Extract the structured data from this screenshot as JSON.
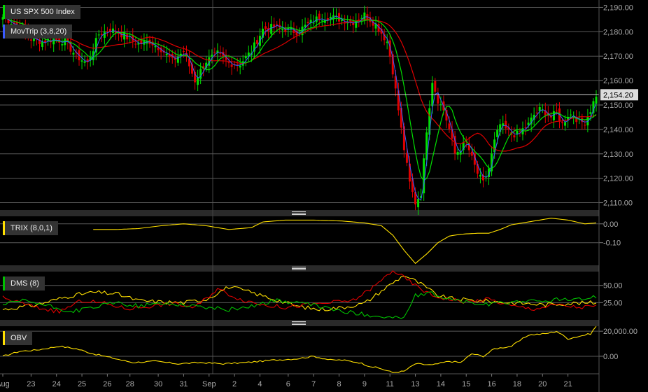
{
  "chart_data": [
    {
      "type": "candlestick",
      "title": "US SPX 500 Index",
      "ylim": [
        2107,
        2193
      ],
      "y_ticks": [
        2110,
        2120,
        2130,
        2140,
        2150,
        2160,
        2170,
        2180,
        2190
      ],
      "y_tick_labels": [
        "2,110.00",
        "2,120.00",
        "2,130.00",
        "2,140.00",
        "2,150.00",
        "2,160.00",
        "2,170.00",
        "2,180.00",
        "2,190.00"
      ],
      "last_price_label": "2,154.20",
      "last_price": 2154.2,
      "series": [
        {
          "name": "US SPX 500 Index",
          "close_anchors": [
            [
              0,
              2186
            ],
            [
              6,
              2182
            ],
            [
              10,
              2177
            ],
            [
              14,
              2176
            ],
            [
              18,
              2177
            ],
            [
              22,
              2176
            ],
            [
              26,
              2170
            ],
            [
              30,
              2167
            ],
            [
              34,
              2179
            ],
            [
              38,
              2181
            ],
            [
              42,
              2179
            ],
            [
              48,
              2175
            ],
            [
              52,
              2176
            ],
            [
              56,
              2173
            ],
            [
              60,
              2168
            ],
            [
              64,
              2172
            ],
            [
              68,
              2160
            ],
            [
              72,
              2168
            ],
            [
              76,
              2171
            ],
            [
              80,
              2167
            ],
            [
              84,
              2167
            ],
            [
              88,
              2172
            ],
            [
              92,
              2181
            ],
            [
              96,
              2182
            ],
            [
              100,
              2181
            ],
            [
              104,
              2180
            ],
            [
              108,
              2183
            ],
            [
              112,
              2186
            ],
            [
              116,
              2186
            ],
            [
              120,
              2185
            ],
            [
              124,
              2184
            ],
            [
              128,
              2187
            ],
            [
              132,
              2183
            ],
            [
              136,
              2176
            ],
            [
              138,
              2164
            ],
            [
              140,
              2148
            ],
            [
              142,
              2132
            ],
            [
              144,
              2118
            ],
            [
              146,
              2110
            ],
            [
              148,
              2114
            ],
            [
              150,
              2140
            ],
            [
              152,
              2160
            ],
            [
              154,
              2152
            ],
            [
              156,
              2148
            ],
            [
              158,
              2140
            ],
            [
              160,
              2130
            ],
            [
              162,
              2132
            ],
            [
              164,
              2135
            ],
            [
              166,
              2128
            ],
            [
              168,
              2122
            ],
            [
              170,
              2118
            ],
            [
              172,
              2124
            ],
            [
              174,
              2135
            ],
            [
              176,
              2142
            ],
            [
              178,
              2140
            ],
            [
              180,
              2138
            ],
            [
              182,
              2138
            ],
            [
              184,
              2140
            ],
            [
              186,
              2142
            ],
            [
              188,
              2146
            ],
            [
              190,
              2148
            ],
            [
              192,
              2147
            ],
            [
              194,
              2145
            ],
            [
              196,
              2147
            ],
            [
              198,
              2142
            ],
            [
              200,
              2146
            ],
            [
              202,
              2146
            ],
            [
              204,
              2143
            ],
            [
              206,
              2143
            ],
            [
              208,
              2148
            ],
            [
              210,
              2154.2
            ]
          ]
        },
        {
          "name": "MovTrip (3,8,20)",
          "label": "MovTrip (3,8,20)",
          "colors": [
            "#00e000",
            "#e00000",
            "#3a5bff"
          ]
        }
      ]
    },
    {
      "type": "line",
      "title": "TRIX (8,0,1)",
      "ylim": [
        -0.22,
        0.04
      ],
      "y_ticks": [
        0.0,
        -0.1
      ],
      "y_tick_labels": [
        "0.00",
        "-0.10"
      ],
      "series": [
        {
          "name": "TRIX",
          "color": "#ffe000",
          "anchors": [
            [
              32,
              -0.03
            ],
            [
              40,
              -0.03
            ],
            [
              48,
              -0.025
            ],
            [
              56,
              -0.01
            ],
            [
              64,
              0.0
            ],
            [
              72,
              -0.01
            ],
            [
              80,
              -0.03
            ],
            [
              88,
              -0.02
            ],
            [
              92,
              0.01
            ],
            [
              100,
              0.02
            ],
            [
              110,
              0.02
            ],
            [
              120,
              0.015
            ],
            [
              128,
              0.005
            ],
            [
              134,
              -0.01
            ],
            [
              138,
              -0.06
            ],
            [
              142,
              -0.14
            ],
            [
              146,
              -0.21
            ],
            [
              150,
              -0.16
            ],
            [
              154,
              -0.1
            ],
            [
              158,
              -0.065
            ],
            [
              162,
              -0.055
            ],
            [
              168,
              -0.05
            ],
            [
              172,
              -0.05
            ],
            [
              176,
              -0.03
            ],
            [
              180,
              -0.005
            ],
            [
              186,
              0.01
            ],
            [
              194,
              0.03
            ],
            [
              200,
              0.02
            ],
            [
              206,
              0.0
            ],
            [
              210,
              0.005
            ]
          ]
        }
      ]
    },
    {
      "type": "line",
      "title": "DMS (8)",
      "ylim": [
        0,
        70
      ],
      "y_ticks": [
        50,
        25
      ],
      "y_tick_labels": [
        "50.00",
        "25.00"
      ],
      "series": [
        {
          "name": "yellow",
          "color": "#ffe000",
          "anchors": [
            [
              0,
              15
            ],
            [
              12,
              22
            ],
            [
              24,
              35
            ],
            [
              32,
              40
            ],
            [
              40,
              38
            ],
            [
              48,
              28
            ],
            [
              56,
              26
            ],
            [
              64,
              25
            ],
            [
              72,
              30
            ],
            [
              80,
              48
            ],
            [
              86,
              42
            ],
            [
              96,
              30
            ],
            [
              104,
              20
            ],
            [
              112,
              15
            ],
            [
              120,
              18
            ],
            [
              128,
              24
            ],
            [
              136,
              48
            ],
            [
              142,
              65
            ],
            [
              148,
              52
            ],
            [
              154,
              35
            ],
            [
              160,
              30
            ],
            [
              168,
              28
            ],
            [
              176,
              26
            ],
            [
              184,
              24
            ],
            [
              192,
              22
            ],
            [
              200,
              24
            ],
            [
              210,
              25
            ]
          ]
        },
        {
          "name": "red",
          "color": "#e00000",
          "anchors": [
            [
              0,
              32
            ],
            [
              12,
              18
            ],
            [
              20,
              12
            ],
            [
              28,
              28
            ],
            [
              36,
              24
            ],
            [
              44,
              16
            ],
            [
              52,
              20
            ],
            [
              60,
              24
            ],
            [
              68,
              18
            ],
            [
              76,
              45
            ],
            [
              84,
              30
            ],
            [
              92,
              22
            ],
            [
              100,
              18
            ],
            [
              108,
              22
            ],
            [
              116,
              25
            ],
            [
              124,
              28
            ],
            [
              132,
              50
            ],
            [
              138,
              72
            ],
            [
              146,
              50
            ],
            [
              152,
              35
            ],
            [
              158,
              30
            ],
            [
              164,
              26
            ],
            [
              172,
              30
            ],
            [
              180,
              20
            ],
            [
              188,
              16
            ],
            [
              196,
              22
            ],
            [
              204,
              18
            ],
            [
              210,
              20
            ]
          ]
        },
        {
          "name": "green",
          "color": "#00c000",
          "anchors": [
            [
              0,
              22
            ],
            [
              8,
              28
            ],
            [
              16,
              20
            ],
            [
              24,
              12
            ],
            [
              32,
              18
            ],
            [
              40,
              25
            ],
            [
              48,
              20
            ],
            [
              56,
              24
            ],
            [
              64,
              22
            ],
            [
              72,
              18
            ],
            [
              80,
              15
            ],
            [
              88,
              20
            ],
            [
              96,
              28
            ],
            [
              104,
              25
            ],
            [
              112,
              20
            ],
            [
              120,
              12
            ],
            [
              128,
              8
            ],
            [
              136,
              4
            ],
            [
              142,
              3
            ],
            [
              146,
              35
            ],
            [
              152,
              38
            ],
            [
              158,
              30
            ],
            [
              164,
              26
            ],
            [
              170,
              22
            ],
            [
              176,
              24
            ],
            [
              184,
              28
            ],
            [
              190,
              26
            ],
            [
              196,
              30
            ],
            [
              202,
              28
            ],
            [
              210,
              34
            ]
          ]
        }
      ]
    },
    {
      "type": "line",
      "title": "OBV",
      "ylim": [
        -14000,
        24000
      ],
      "y_ticks": [
        20000,
        0
      ],
      "y_tick_labels": [
        "20,000.00",
        "0.00"
      ],
      "series": [
        {
          "name": "OBV",
          "color": "#ffe000",
          "anchors": [
            [
              0,
              0
            ],
            [
              6,
              4000
            ],
            [
              12,
              5000
            ],
            [
              20,
              8000
            ],
            [
              26,
              6000
            ],
            [
              32,
              2000
            ],
            [
              40,
              -2000
            ],
            [
              46,
              -5000
            ],
            [
              54,
              -4000
            ],
            [
              62,
              -6000
            ],
            [
              70,
              -5000
            ],
            [
              78,
              -6000
            ],
            [
              86,
              -5000
            ],
            [
              96,
              -3000
            ],
            [
              104,
              -2000
            ],
            [
              110,
              0
            ],
            [
              116,
              -3000
            ],
            [
              120,
              -3000
            ],
            [
              126,
              -5000
            ],
            [
              130,
              -8000
            ],
            [
              134,
              -10000
            ],
            [
              138,
              -13000
            ],
            [
              142,
              -12000
            ],
            [
              146,
              -6000
            ],
            [
              152,
              -7000
            ],
            [
              158,
              -4000
            ],
            [
              162,
              -5000
            ],
            [
              166,
              2000
            ],
            [
              170,
              0
            ],
            [
              174,
              6000
            ],
            [
              180,
              8000
            ],
            [
              186,
              17000
            ],
            [
              192,
              18000
            ],
            [
              196,
              20000
            ],
            [
              200,
              14000
            ],
            [
              204,
              16000
            ],
            [
              208,
              18000
            ],
            [
              210,
              24000
            ]
          ]
        }
      ]
    }
  ],
  "x_axis": {
    "labels": [
      {
        "i": 0,
        "text": "Aug"
      },
      {
        "i": 10,
        "text": "23"
      },
      {
        "i": 19,
        "text": "24"
      },
      {
        "i": 28,
        "text": "25"
      },
      {
        "i": 37,
        "text": "26"
      },
      {
        "i": 45,
        "text": "28"
      },
      {
        "i": 55,
        "text": "30"
      },
      {
        "i": 64,
        "text": "31"
      },
      {
        "i": 73,
        "text": "Sep"
      },
      {
        "i": 82,
        "text": "2"
      },
      {
        "i": 91,
        "text": "4"
      },
      {
        "i": 101,
        "text": "6"
      },
      {
        "i": 110,
        "text": "7"
      },
      {
        "i": 119,
        "text": "8"
      },
      {
        "i": 128,
        "text": "9"
      },
      {
        "i": 137,
        "text": "11"
      },
      {
        "i": 146,
        "text": "13"
      },
      {
        "i": 155,
        "text": "14"
      },
      {
        "i": 164,
        "text": "15"
      },
      {
        "i": 173,
        "text": "16"
      },
      {
        "i": 182,
        "text": "18"
      },
      {
        "i": 191,
        "text": "20"
      },
      {
        "i": 200,
        "text": "21"
      }
    ]
  },
  "legends": {
    "price": "US SPX 500 Index",
    "movtrip": "MovTrip (3,8,20)",
    "trix": "TRIX (8,0,1)",
    "dms": "DMS (8)",
    "obv": "OBV"
  },
  "colors": {
    "up": "#00e000",
    "down": "#e00000",
    "line_yellow": "#ffe000",
    "grid": "#5a5a5a",
    "background": "#000000"
  }
}
